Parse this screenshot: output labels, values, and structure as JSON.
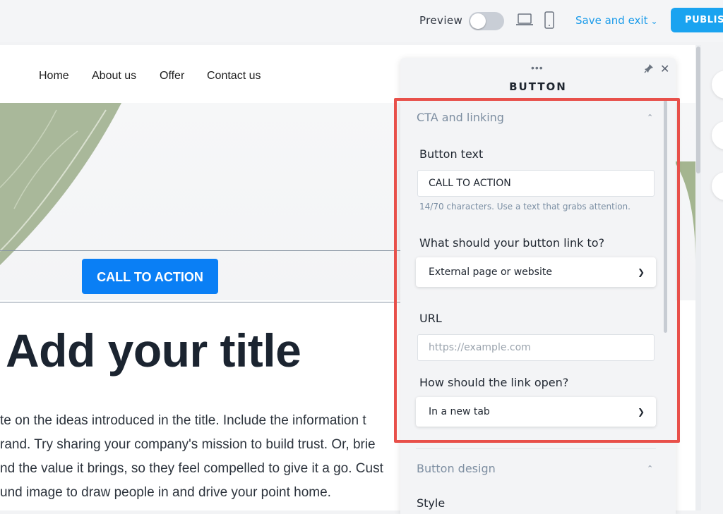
{
  "topbar": {
    "preview_label": "Preview",
    "preview_toggle": "off",
    "desktop_icon": "laptop-icon",
    "mobile_icon": "phone-icon",
    "save_exit_label": "Save and exit",
    "publish_label": "PUBLISH"
  },
  "site": {
    "nav": [
      "Home",
      "About us",
      "Offer",
      "Contact us"
    ],
    "cta_label": "CALL TO ACTION",
    "title": "Add your title",
    "paragraph": [
      "te on the ideas introduced in the title. Include the information t",
      "rand. Try sharing your company's mission to build trust. Or, brie",
      "nd the value it brings, so they feel compelled to give it a go. Cust",
      "und image to draw people in and drive your point home."
    ]
  },
  "panel": {
    "drag_handle": "•••",
    "title": "BUTTON",
    "section1": {
      "heading": "CTA and linking",
      "button_text_label": "Button text",
      "button_text_value": "CALL TO ACTION",
      "button_text_helper": "14/70 characters. Use a text that grabs attention.",
      "link_label": "What should your button link to?",
      "link_value": "External page or website",
      "url_label": "URL",
      "url_placeholder": "https://example.com",
      "open_label": "How should the link open?",
      "open_value": "In a new tab"
    },
    "section2": {
      "heading": "Button design",
      "style_label": "Style"
    }
  },
  "colors": {
    "accent": "#1aa3f0",
    "cta_blue": "#0a7ff5",
    "highlight": "#e8504a"
  }
}
